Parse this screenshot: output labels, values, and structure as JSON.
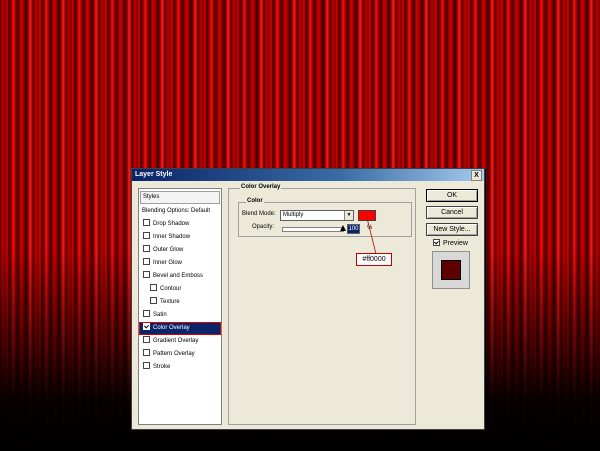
{
  "dialog": {
    "title": "Layer Style",
    "close_glyph": "X"
  },
  "styles_panel": {
    "header": "Styles",
    "items": [
      {
        "label": "Blending Options: Default",
        "has_checkbox": false,
        "checked": false,
        "selected": false,
        "indent": false
      },
      {
        "label": "Drop Shadow",
        "has_checkbox": true,
        "checked": false,
        "selected": false,
        "indent": false
      },
      {
        "label": "Inner Shadow",
        "has_checkbox": true,
        "checked": false,
        "selected": false,
        "indent": false
      },
      {
        "label": "Outer Glow",
        "has_checkbox": true,
        "checked": false,
        "selected": false,
        "indent": false
      },
      {
        "label": "Inner Glow",
        "has_checkbox": true,
        "checked": false,
        "selected": false,
        "indent": false
      },
      {
        "label": "Bevel and Emboss",
        "has_checkbox": true,
        "checked": false,
        "selected": false,
        "indent": false
      },
      {
        "label": "Contour",
        "has_checkbox": true,
        "checked": false,
        "selected": false,
        "indent": true
      },
      {
        "label": "Texture",
        "has_checkbox": true,
        "checked": false,
        "selected": false,
        "indent": true
      },
      {
        "label": "Satin",
        "has_checkbox": true,
        "checked": false,
        "selected": false,
        "indent": false
      },
      {
        "label": "Color Overlay",
        "has_checkbox": true,
        "checked": true,
        "selected": true,
        "indent": false
      },
      {
        "label": "Gradient Overlay",
        "has_checkbox": true,
        "checked": false,
        "selected": false,
        "indent": false
      },
      {
        "label": "Pattern Overlay",
        "has_checkbox": true,
        "checked": false,
        "selected": false,
        "indent": false
      },
      {
        "label": "Stroke",
        "has_checkbox": true,
        "checked": false,
        "selected": false,
        "indent": false
      }
    ]
  },
  "color_overlay": {
    "group_title": "Color Overlay",
    "subgroup_title": "Color",
    "blend_mode_label": "Blend Mode:",
    "blend_mode_value": "Multiply",
    "opacity_label": "Opacity:",
    "opacity_value": "100",
    "opacity_unit": "%",
    "opacity_fraction": 1.0,
    "swatch_color": "#ff0000",
    "hex_callout": "#ff0000"
  },
  "buttons": {
    "ok": "OK",
    "cancel": "Cancel",
    "new_style": "New Style..."
  },
  "preview": {
    "label": "Preview",
    "checked": true,
    "swatch_color": "#5c0000"
  },
  "colors": {
    "selection": "#0a246a",
    "callout_border": "#c00000",
    "curtain_red": "#c40000"
  }
}
